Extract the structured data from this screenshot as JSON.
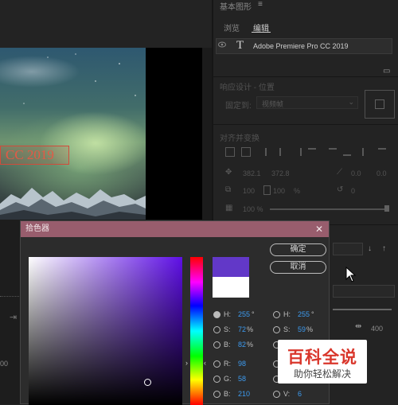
{
  "panel": {
    "title": "基本图形",
    "menu_icon": "hamburger-icon",
    "tabs": [
      {
        "label": "浏览",
        "active": false
      },
      {
        "label": "编辑",
        "active": true
      }
    ],
    "layer": {
      "name": "Adobe Premiere Pro CC 2019",
      "type_icon": "T"
    },
    "responsive_title": "响应设计 - 位置",
    "pin_label": "固定到:",
    "pin_value": "视频帧",
    "align_title": "对齐并变换",
    "position": {
      "x": "382.1",
      "y": "372.8"
    },
    "anchor": {
      "x": "0.0",
      "y": "0.0"
    },
    "scale": {
      "value": "100",
      "value2": "100",
      "unit": "%"
    },
    "rotation": "0",
    "opacity": "100 %",
    "tracking_value": "400"
  },
  "monitor": {
    "title_text": "CC 2019",
    "time_fragment": "00"
  },
  "picker": {
    "title": "拾色器",
    "ok_label": "确定",
    "cancel_label": "取消",
    "colors": {
      "new": "#6238c8",
      "old": "#ffffff",
      "accent": "#3d9bf0"
    },
    "hsb": [
      {
        "label": "H:",
        "value": "255",
        "unit": "°",
        "selected": true
      },
      {
        "label": "S:",
        "value": "72",
        "unit": "%",
        "selected": false
      },
      {
        "label": "B:",
        "value": "82",
        "unit": "%",
        "selected": false
      }
    ],
    "rgb": [
      {
        "label": "R:",
        "value": "98"
      },
      {
        "label": "G:",
        "value": "58"
      },
      {
        "label": "B:",
        "value": "210"
      }
    ],
    "hsl": [
      {
        "label": "H:",
        "value": "255",
        "unit": "°"
      },
      {
        "label": "S:",
        "value": "59",
        "unit": "%"
      },
      {
        "label": "L:",
        "value": ""
      },
      {
        "label": "U:",
        "value": ""
      },
      {
        "label": "V:",
        "value": "6"
      }
    ]
  },
  "watermark": {
    "main": "百科全说",
    "sub": "助你轻松解决"
  }
}
